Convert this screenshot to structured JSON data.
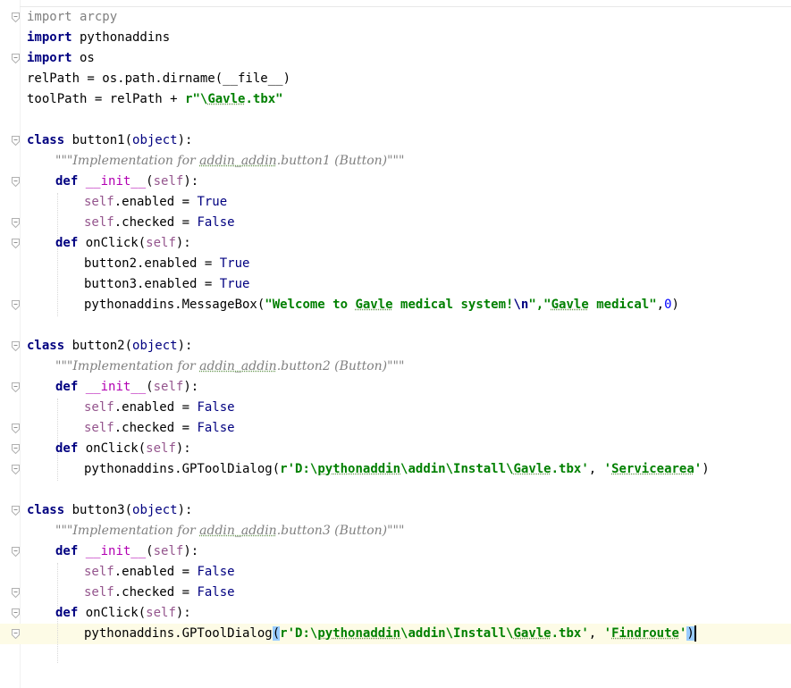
{
  "editor": {
    "lines": [
      {
        "indent": 0,
        "parts": [
          {
            "t": "import",
            "c": "kwi"
          },
          {
            "t": " arcpy",
            "c": "kwi"
          }
        ]
      },
      {
        "indent": 0,
        "parts": [
          {
            "t": "import",
            "c": "kw"
          },
          {
            "t": " pythonaddins",
            "c": ""
          }
        ]
      },
      {
        "indent": 0,
        "parts": [
          {
            "t": "import",
            "c": "kw"
          },
          {
            "t": " os",
            "c": ""
          }
        ]
      },
      {
        "indent": 0,
        "parts": [
          {
            "t": "relPath = os.path.dirname(__file__)",
            "c": ""
          }
        ]
      },
      {
        "indent": 0,
        "parts": [
          {
            "t": "toolPath = relPath + ",
            "c": ""
          },
          {
            "t": "r\"\\",
            "c": "str"
          },
          {
            "t": "Gavle",
            "c": "str spell"
          },
          {
            "t": ".tbx\"",
            "c": "str"
          }
        ]
      },
      {
        "indent": 0,
        "parts": []
      },
      {
        "indent": 0,
        "parts": [
          {
            "t": "class",
            "c": "kw"
          },
          {
            "t": " button1(",
            "c": ""
          },
          {
            "t": "object",
            "c": "bi"
          },
          {
            "t": "):",
            "c": ""
          }
        ]
      },
      {
        "indent": 1,
        "parts": [
          {
            "t": "\"\"\"Implementation for ",
            "c": "doc"
          },
          {
            "t": "addin_addin",
            "c": "doc spell"
          },
          {
            "t": ".button1 (Button)\"\"\"",
            "c": "doc"
          }
        ]
      },
      {
        "indent": 1,
        "parts": [
          {
            "t": "def",
            "c": "kw"
          },
          {
            "t": " ",
            "c": ""
          },
          {
            "t": "__init__",
            "c": "dunder"
          },
          {
            "t": "(",
            "c": ""
          },
          {
            "t": "self",
            "c": "self"
          },
          {
            "t": "):",
            "c": ""
          }
        ]
      },
      {
        "indent": 2,
        "parts": [
          {
            "t": "self",
            "c": "self"
          },
          {
            "t": ".enabled = ",
            "c": ""
          },
          {
            "t": "True",
            "c": "bi"
          }
        ]
      },
      {
        "indent": 2,
        "parts": [
          {
            "t": "self",
            "c": "self"
          },
          {
            "t": ".checked = ",
            "c": ""
          },
          {
            "t": "False",
            "c": "bi"
          }
        ]
      },
      {
        "indent": 1,
        "parts": [
          {
            "t": "def",
            "c": "kw"
          },
          {
            "t": " onClick(",
            "c": ""
          },
          {
            "t": "self",
            "c": "self"
          },
          {
            "t": "):",
            "c": ""
          }
        ]
      },
      {
        "indent": 2,
        "parts": [
          {
            "t": "button2.enabled = ",
            "c": ""
          },
          {
            "t": "True",
            "c": "bi"
          }
        ]
      },
      {
        "indent": 2,
        "parts": [
          {
            "t": "button3.enabled = ",
            "c": ""
          },
          {
            "t": "True",
            "c": "bi"
          }
        ]
      },
      {
        "indent": 2,
        "parts": [
          {
            "t": "pythonaddins.MessageBox(",
            "c": ""
          },
          {
            "t": "\"Welcome to ",
            "c": "str"
          },
          {
            "t": "Gavle",
            "c": "str spell"
          },
          {
            "t": " medical system!",
            "c": "str"
          },
          {
            "t": "\\n",
            "c": "esc"
          },
          {
            "t": "\",\"",
            "c": "str"
          },
          {
            "t": "Gavle",
            "c": "str spell"
          },
          {
            "t": " medical\"",
            "c": "str"
          },
          {
            "t": ",",
            "c": ""
          },
          {
            "t": "0",
            "c": "num"
          },
          {
            "t": ")",
            "c": ""
          }
        ]
      },
      {
        "indent": 0,
        "parts": []
      },
      {
        "indent": 0,
        "parts": [
          {
            "t": "class",
            "c": "kw"
          },
          {
            "t": " button2(",
            "c": ""
          },
          {
            "t": "object",
            "c": "bi"
          },
          {
            "t": "):",
            "c": ""
          }
        ]
      },
      {
        "indent": 1,
        "parts": [
          {
            "t": "\"\"\"Implementation for ",
            "c": "doc"
          },
          {
            "t": "addin_addin",
            "c": "doc spell"
          },
          {
            "t": ".button2 (Button)\"\"\"",
            "c": "doc"
          }
        ]
      },
      {
        "indent": 1,
        "parts": [
          {
            "t": "def",
            "c": "kw"
          },
          {
            "t": " ",
            "c": ""
          },
          {
            "t": "__init__",
            "c": "dunder"
          },
          {
            "t": "(",
            "c": ""
          },
          {
            "t": "self",
            "c": "self"
          },
          {
            "t": "):",
            "c": ""
          }
        ]
      },
      {
        "indent": 2,
        "parts": [
          {
            "t": "self",
            "c": "self"
          },
          {
            "t": ".enabled = ",
            "c": ""
          },
          {
            "t": "False",
            "c": "bi"
          }
        ]
      },
      {
        "indent": 2,
        "parts": [
          {
            "t": "self",
            "c": "self"
          },
          {
            "t": ".checked = ",
            "c": ""
          },
          {
            "t": "False",
            "c": "bi"
          }
        ]
      },
      {
        "indent": 1,
        "parts": [
          {
            "t": "def",
            "c": "kw"
          },
          {
            "t": " onClick(",
            "c": ""
          },
          {
            "t": "self",
            "c": "self"
          },
          {
            "t": "):",
            "c": ""
          }
        ]
      },
      {
        "indent": 2,
        "parts": [
          {
            "t": "pythonaddins.GPToolDialog(",
            "c": ""
          },
          {
            "t": "r'D:\\",
            "c": "str"
          },
          {
            "t": "pythonaddin",
            "c": "str spell"
          },
          {
            "t": "\\addin\\Install\\",
            "c": "str"
          },
          {
            "t": "Gavle",
            "c": "str spell"
          },
          {
            "t": ".tbx'",
            "c": "str"
          },
          {
            "t": ", ",
            "c": ""
          },
          {
            "t": "'",
            "c": "str"
          },
          {
            "t": "Servicearea",
            "c": "str spell"
          },
          {
            "t": "'",
            "c": "str"
          },
          {
            "t": ")",
            "c": ""
          }
        ]
      },
      {
        "indent": 0,
        "parts": []
      },
      {
        "indent": 0,
        "parts": [
          {
            "t": "class",
            "c": "kw"
          },
          {
            "t": " button3(",
            "c": ""
          },
          {
            "t": "object",
            "c": "bi"
          },
          {
            "t": "):",
            "c": ""
          }
        ]
      },
      {
        "indent": 1,
        "parts": [
          {
            "t": "\"\"\"Implementation for ",
            "c": "doc"
          },
          {
            "t": "addin_addin",
            "c": "doc spell"
          },
          {
            "t": ".button3 (Button)\"\"\"",
            "c": "doc"
          }
        ]
      },
      {
        "indent": 1,
        "parts": [
          {
            "t": "def",
            "c": "kw"
          },
          {
            "t": " ",
            "c": ""
          },
          {
            "t": "__init__",
            "c": "dunder"
          },
          {
            "t": "(",
            "c": ""
          },
          {
            "t": "self",
            "c": "self"
          },
          {
            "t": "):",
            "c": ""
          }
        ]
      },
      {
        "indent": 2,
        "parts": [
          {
            "t": "self",
            "c": "self"
          },
          {
            "t": ".enabled = ",
            "c": ""
          },
          {
            "t": "False",
            "c": "bi"
          }
        ]
      },
      {
        "indent": 2,
        "parts": [
          {
            "t": "self",
            "c": "self"
          },
          {
            "t": ".checked = ",
            "c": ""
          },
          {
            "t": "False",
            "c": "bi"
          }
        ]
      },
      {
        "indent": 1,
        "parts": [
          {
            "t": "def",
            "c": "kw"
          },
          {
            "t": " onClick(",
            "c": ""
          },
          {
            "t": "self",
            "c": "self"
          },
          {
            "t": "):",
            "c": ""
          }
        ]
      },
      {
        "indent": 2,
        "parts": [
          {
            "t": "pythonaddins.GPToolDialog",
            "c": ""
          },
          {
            "t": "(",
            "c": "brace-hl"
          },
          {
            "t": "r'D:\\",
            "c": "str"
          },
          {
            "t": "pythonaddin",
            "c": "str spell"
          },
          {
            "t": "\\addin\\Install\\",
            "c": "str"
          },
          {
            "t": "Gavle",
            "c": "str spell"
          },
          {
            "t": ".tbx'",
            "c": "str"
          },
          {
            "t": ", ",
            "c": ""
          },
          {
            "t": "'",
            "c": "str"
          },
          {
            "t": "Findroute",
            "c": "str spell"
          },
          {
            "t": "'",
            "c": "str"
          },
          {
            "t": ")",
            "c": "brace-hl"
          },
          {
            "t": "",
            "c": "caret"
          }
        ]
      }
    ],
    "current_line": 30,
    "fold_markers": [
      0,
      2,
      6,
      8,
      10,
      11,
      14,
      16,
      18,
      20,
      21,
      22,
      24,
      26,
      28,
      29,
      30
    ],
    "colors": {
      "keyword": "#000080",
      "string": "#008000",
      "docstring": "#808080",
      "self": "#94558d",
      "number": "#0000ff",
      "current_line_bg": "#fdfbe6",
      "brace_match": "#99ccff"
    }
  }
}
